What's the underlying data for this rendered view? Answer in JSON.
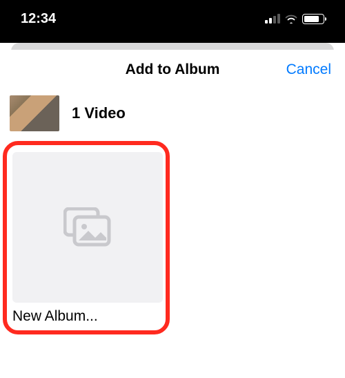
{
  "status_bar": {
    "time": "12:34"
  },
  "sheet": {
    "title": "Add to Album",
    "cancel_label": "Cancel",
    "selection_label": "1 Video"
  },
  "albums": {
    "new_album_label": "New Album..."
  },
  "colors": {
    "accent": "#007aff",
    "highlight": "#ff2a1f"
  }
}
